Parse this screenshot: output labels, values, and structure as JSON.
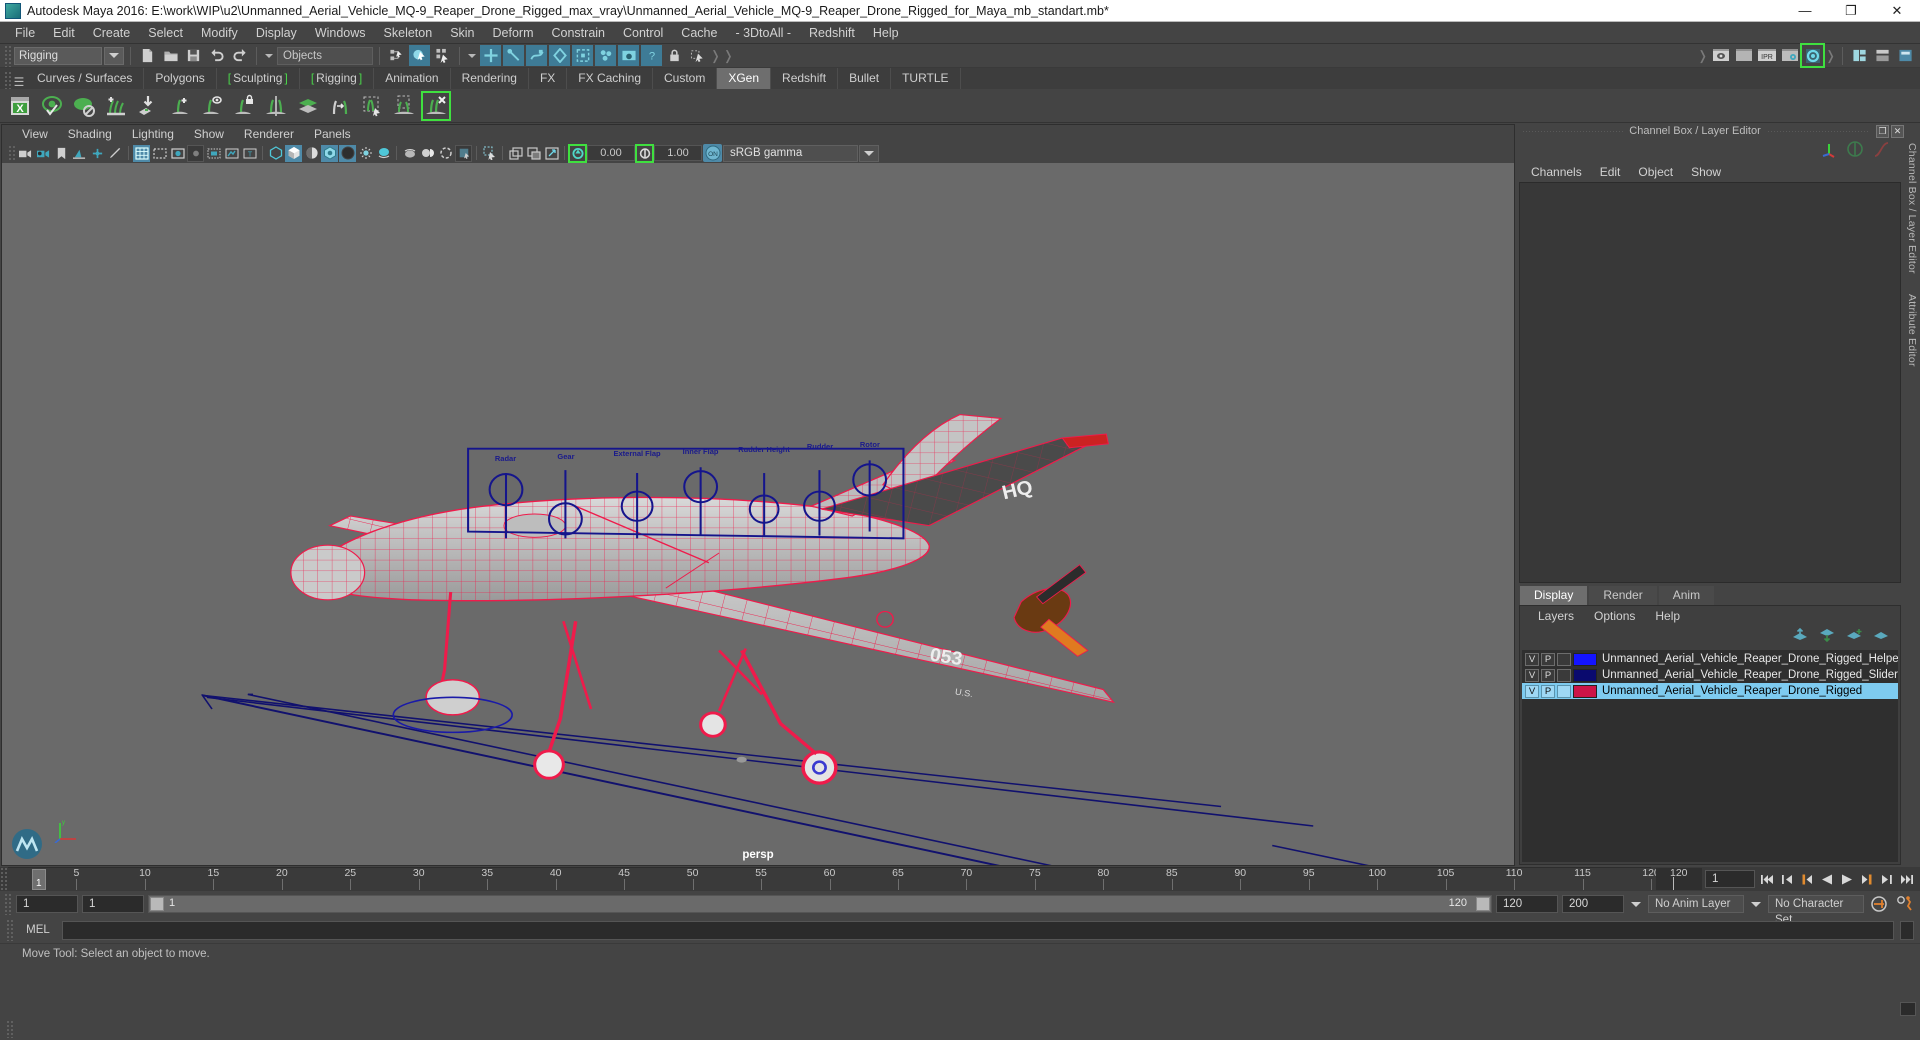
{
  "window": {
    "title": "Autodesk Maya 2016: E:\\work\\WIP\\u2\\Unmanned_Aerial_Vehicle_MQ-9_Reaper_Drone_Rigged_max_vray\\Unmanned_Aerial_Vehicle_MQ-9_Reaper_Drone_Rigged_for_Maya_mb_standart.mb*",
    "minimize": "—",
    "maximize": "❐",
    "close": "✕"
  },
  "menubar": [
    "File",
    "Edit",
    "Create",
    "Select",
    "Modify",
    "Display",
    "Windows",
    "Skeleton",
    "Skin",
    "Deform",
    "Constrain",
    "Control",
    "Cache",
    "- 3DtoAll -",
    "Redshift",
    "Help"
  ],
  "statusbar": {
    "menuset": "Rigging",
    "objects_field": "Objects",
    "icons": [
      "new-scene-icon",
      "open-scene-icon",
      "save-scene-icon",
      "undo-icon",
      "redo-icon",
      "select-hierarchy-icon",
      "select-object-icon",
      "select-component-icon",
      "snap-grid-icon",
      "snap-curve-icon",
      "snap-point-icon",
      "snap-view-plane-icon",
      "snap-projected-center-icon",
      "make-live-icon",
      "render-settings-icon",
      "help-icon",
      "lock-icon",
      "select-by-name-icon",
      "render-view-icon",
      "render-current-frame-icon",
      "ipr-render-icon",
      "render-settings-gear-icon",
      "hypershade-icon"
    ],
    "ipr_label": "IPR"
  },
  "shelf": {
    "tabs": [
      {
        "label": "Curves / Surfaces",
        "active": false,
        "bracket": false
      },
      {
        "label": "Polygons",
        "active": false,
        "bracket": false
      },
      {
        "label": "Sculpting",
        "active": false,
        "bracket": true
      },
      {
        "label": "Rigging",
        "active": false,
        "bracket": true
      },
      {
        "label": "Animation",
        "active": false,
        "bracket": false
      },
      {
        "label": "Rendering",
        "active": false,
        "bracket": false
      },
      {
        "label": "FX",
        "active": false,
        "bracket": false
      },
      {
        "label": "FX Caching",
        "active": false,
        "bracket": false
      },
      {
        "label": "Custom",
        "active": false,
        "bracket": false
      },
      {
        "label": "XGen",
        "active": true,
        "bracket": false
      },
      {
        "label": "Redshift",
        "active": false,
        "bracket": false
      },
      {
        "label": "Bullet",
        "active": false,
        "bracket": false
      },
      {
        "label": "TURTLE",
        "active": false,
        "bracket": false
      }
    ],
    "icons": [
      "xgen-window-icon",
      "xgen-preview-icon",
      "xgen-no-selection-icon",
      "xgen-add-description-icon",
      "xgen-import-collection-icon",
      "xgen-add-guide-icon",
      "xgen-guide-display-icon",
      "xgen-lock-guide-icon",
      "xgen-mirror-guide-icon",
      "xgen-density-map-icon",
      "xgen-convert-guides-icon",
      "xgen-clump-icon",
      "xgen-region-icon",
      "xgen-delete-guide-icon"
    ]
  },
  "viewport": {
    "menus": [
      "View",
      "Shading",
      "Lighting",
      "Show",
      "Renderer",
      "Panels"
    ],
    "toolbar": {
      "exposure": "0.00",
      "gamma": "1.00",
      "color_profile": "sRGB gamma",
      "toggle_on_label": "ON",
      "icons": [
        "select-camera-icon",
        "camera-attributes-icon",
        "bookmark-icon",
        "image-plane-icon",
        "two-pane-icon",
        "grease-pencil-icon",
        "grid-icon",
        "film-gate-icon",
        "resolution-gate-icon",
        "gate-mask-icon",
        "film-origin-icon",
        "safe-action-icon",
        "text-overlay-icon",
        "wireframe-icon",
        "smooth-shade-icon",
        "shade-x-ray-icon",
        "shaded-textured-icon",
        "hardware-texturing-icon",
        "use-all-lights-icon",
        "shadows-icon",
        "screen-space-ao-icon",
        "motion-blur-icon",
        "multisample-icon",
        "isolate-select-icon",
        "xray-joints-icon",
        "panel-layout-icon",
        "panel-copy-icon",
        "snapshot-icon",
        "exposure-icon",
        "gamma-icon",
        "view-transform-icon"
      ]
    },
    "camera_label": "persp",
    "rig_panel": {
      "slider_labels": [
        "Radar",
        "Gear",
        "External Flap",
        "Inner Flap",
        "Rudder Height",
        "Rudder",
        "Rotor"
      ],
      "outline_color": "#1a1a8c"
    },
    "scene_decals": [
      "HQ",
      "053"
    ],
    "background_color": "#6a6a6a",
    "mesh_wire_color": "#ef1b4b"
  },
  "channel_box": {
    "title": "Channel Box / Layer Editor",
    "undock_icon": "❐",
    "close_icon": "✕",
    "tabs": [
      "Channels",
      "Edit",
      "Object",
      "Show"
    ],
    "side_tabs": [
      "Channel Box / Layer Editor",
      "Attribute Editor"
    ]
  },
  "layer_editor": {
    "tabs": [
      {
        "label": "Display",
        "active": true
      },
      {
        "label": "Render",
        "active": false
      },
      {
        "label": "Anim",
        "active": false
      }
    ],
    "menus": [
      "Layers",
      "Options",
      "Help"
    ],
    "buttons": [
      "move-layer-up-icon",
      "move-layer-down-icon",
      "new-layer-icon",
      "new-layer-from-selected-icon"
    ],
    "column_v": "V",
    "column_p": "P",
    "layers": [
      {
        "v": "V",
        "p": "P",
        "color": "#1414ff",
        "name": "Unmanned_Aerial_Vehicle_Reaper_Drone_Rigged_Helpe",
        "selected": false
      },
      {
        "v": "V",
        "p": "P",
        "color": "#0a0a6e",
        "name": "Unmanned_Aerial_Vehicle_Reaper_Drone_Rigged_Slider",
        "selected": false
      },
      {
        "v": "V",
        "p": "P",
        "color": "#cc1447",
        "name": "Unmanned_Aerial_Vehicle_Reaper_Drone_Rigged",
        "selected": true
      }
    ]
  },
  "timeline": {
    "ticks": [
      5,
      10,
      15,
      20,
      25,
      30,
      35,
      40,
      45,
      50,
      55,
      60,
      65,
      70,
      75,
      80,
      85,
      90,
      95,
      100,
      105,
      110,
      115,
      120
    ],
    "current_frame": "1",
    "end_marker": "120",
    "frame_field": "1",
    "playback_buttons": [
      "go-to-start-icon",
      "step-back-keyframe-icon",
      "step-back-frame-icon",
      "play-backwards-icon",
      "play-forwards-icon",
      "step-forward-frame-icon",
      "step-forward-keyframe-icon",
      "go-to-end-icon"
    ]
  },
  "range_bar": {
    "anim_start": "1",
    "range_start": "1",
    "slider_label": "1",
    "slider_end_label": "120",
    "range_end": "120",
    "anim_end": "200",
    "anim_layer": "No Anim Layer",
    "character_set": "No Character Set",
    "icons": [
      "auto-key-icon",
      "animation-preferences-icon"
    ]
  },
  "command_line": {
    "language": "MEL",
    "input_value": "",
    "script_editor_icon": "script-editor-icon"
  },
  "help_line": {
    "text": "Move Tool: Select an object to move."
  }
}
